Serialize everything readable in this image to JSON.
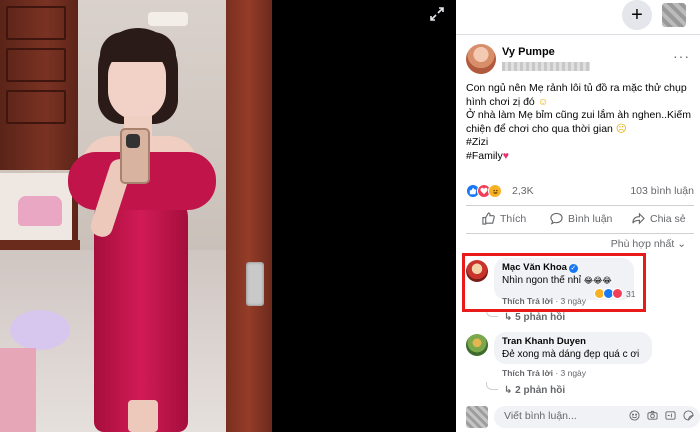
{
  "viewer": {
    "expand_icon": "expand-icon"
  },
  "topbar": {
    "plus_label": "+"
  },
  "post": {
    "author": "Vy Pumpe",
    "more_label": "···",
    "lines": [
      "Con ngủ nên Mẹ rảnh lôi tủ đồ ra mặc thử chụp",
      "hình chơi zị đó"
    ],
    "line3": "Ở nhà làm Mẹ bỉm cũng zui lắm àh nghen..Kiếm",
    "line4": "chiện để chơi cho qua thời gian",
    "hashtag1": "#Zizi",
    "hashtag2": "#Family",
    "emoji_smile": "☺",
    "emoji_sad": "☹",
    "heart": "♥",
    "reaction_count": "2,3K",
    "comment_count": "103 bình luận"
  },
  "actions": {
    "like": "Thích",
    "comment": "Bình luận",
    "share": "Chia sẻ"
  },
  "sort_label": "Phù hợp nhất ⌄",
  "comments": [
    {
      "name": "Mạc Văn Khoa",
      "verified": "✓",
      "text": "Nhìn ngon thế nhỉ",
      "emojis": "😂😂😂",
      "like_label": "Thích",
      "reply_label": "Trả lời",
      "time": "· 3 ngày",
      "react_count": "31",
      "replies": "5 phản hồi"
    },
    {
      "name": "Tran Khanh Duyen",
      "text": "Đẻ xong mà dáng đẹp quá c ơi",
      "like_label": "Thích",
      "reply_label": "Trả lời",
      "time": "· 3 ngày",
      "replies": "2 phản hồi"
    }
  ],
  "composer": {
    "placeholder": "Viết bình luận..."
  },
  "colors": {
    "accent": "#1877f2",
    "highlight": "#e81a1a",
    "love": "#f33e58",
    "haha": "#f7b125"
  }
}
